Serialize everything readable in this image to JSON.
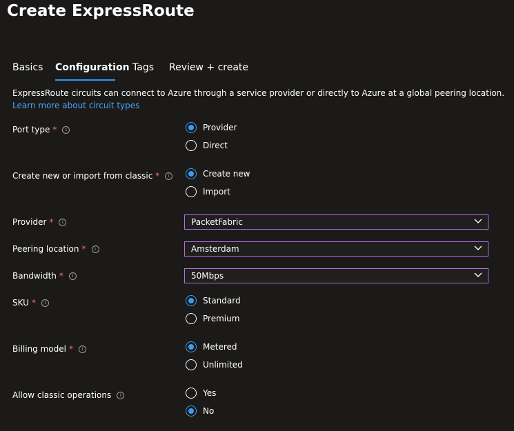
{
  "header": {
    "title": "Create ExpressRoute",
    "more": "···"
  },
  "tabs": [
    {
      "label": "Basics",
      "active": false
    },
    {
      "label": "Configuration",
      "active": true
    },
    {
      "label": "Tags",
      "active": false
    },
    {
      "label": "Review + create",
      "active": false
    }
  ],
  "description": "ExpressRoute circuits can connect to Azure through a service provider or directly to Azure at a global peering location.",
  "learn_more": "Learn more about circuit types",
  "required_mark": "*",
  "info_glyph": "i",
  "fields": {
    "port_type": {
      "label": "Port type",
      "options": [
        "Provider",
        "Direct"
      ],
      "selected": "Provider"
    },
    "create_new": {
      "label": "Create new or import from classic",
      "options": [
        "Create new",
        "Import"
      ],
      "selected": "Create new"
    },
    "provider": {
      "label": "Provider",
      "value": "PacketFabric"
    },
    "peering_location": {
      "label": "Peering location",
      "value": "Amsterdam"
    },
    "bandwidth": {
      "label": "Bandwidth",
      "value": "50Mbps"
    },
    "sku": {
      "label": "SKU",
      "options": [
        "Standard",
        "Premium"
      ],
      "selected": "Standard"
    },
    "billing_model": {
      "label": "Billing model",
      "options": [
        "Metered",
        "Unlimited"
      ],
      "selected": "Metered"
    },
    "allow_classic": {
      "label": "Allow classic operations",
      "options": [
        "Yes",
        "No"
      ],
      "selected": "No"
    }
  },
  "colors": {
    "background": "#1b1a19",
    "accent": "#3c9cf0",
    "link": "#4aa3f7",
    "required": "#f1707b",
    "dropdown_border": "#b46fe0"
  }
}
